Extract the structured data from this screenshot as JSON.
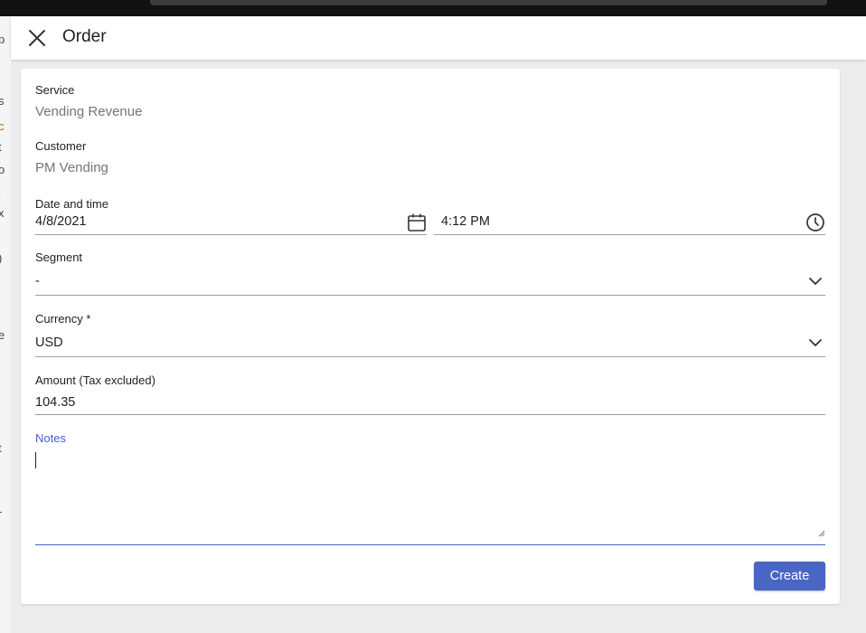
{
  "drawer": {
    "title": "Order",
    "close_icon": "close-icon"
  },
  "form": {
    "service": {
      "label": "Service",
      "value": "Vending Revenue"
    },
    "customer": {
      "label": "Customer",
      "value": "PM Vending"
    },
    "datetime": {
      "label": "Date and time",
      "date": "4/8/2021",
      "time": "4:12 PM",
      "date_icon": "calendar-icon",
      "time_icon": "clock-icon"
    },
    "segment": {
      "label": "Segment",
      "value": "-",
      "icon": "chevron-down-icon"
    },
    "currency": {
      "label": "Currency *",
      "value": "USD",
      "icon": "chevron-down-icon"
    },
    "amount": {
      "label": "Amount (Tax excluded)",
      "value": "104.35"
    },
    "notes": {
      "label": "Notes",
      "value": ""
    }
  },
  "actions": {
    "create_label": "Create",
    "primary_color": "#4a66c4"
  },
  "theme": {
    "focus_color": "#4263c8",
    "muted_text": "#757575"
  }
}
